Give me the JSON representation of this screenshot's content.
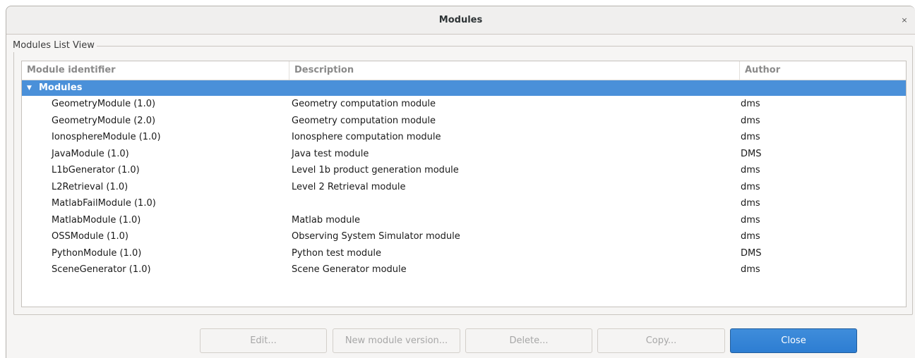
{
  "window": {
    "title": "Modules",
    "close_glyph": "×"
  },
  "group": {
    "label": "Modules List View"
  },
  "tree": {
    "columns": [
      "Module identifier",
      "Description",
      "Author"
    ],
    "group_row": {
      "label": "Modules",
      "expander_icon": "triangle-down-icon"
    },
    "rows": [
      {
        "id": "GeometryModule (1.0)",
        "description": "Geometry computation module",
        "author": "dms"
      },
      {
        "id": "GeometryModule (2.0)",
        "description": "Geometry computation module",
        "author": "dms"
      },
      {
        "id": "IonosphereModule (1.0)",
        "description": "Ionosphere computation module",
        "author": "dms"
      },
      {
        "id": "JavaModule (1.0)",
        "description": "Java test module",
        "author": "DMS"
      },
      {
        "id": "L1bGenerator (1.0)",
        "description": "Level 1b product generation module",
        "author": "dms"
      },
      {
        "id": "L2Retrieval (1.0)",
        "description": "Level 2 Retrieval module",
        "author": "dms"
      },
      {
        "id": "MatlabFailModule (1.0)",
        "description": "",
        "author": "dms"
      },
      {
        "id": "MatlabModule (1.0)",
        "description": "Matlab module",
        "author": "dms"
      },
      {
        "id": "OSSModule (1.0)",
        "description": "Observing System Simulator module",
        "author": "dms"
      },
      {
        "id": "PythonModule (1.0)",
        "description": "Python test module",
        "author": "DMS"
      },
      {
        "id": "SceneGenerator (1.0)",
        "description": "Scene Generator module",
        "author": "dms"
      }
    ]
  },
  "buttons": {
    "edit": "Edit...",
    "new_version": "New module version...",
    "delete": "Delete...",
    "copy": "Copy...",
    "close": "Close"
  },
  "colors": {
    "selection": "#4a90d9",
    "primary_button": "#3584e4"
  }
}
